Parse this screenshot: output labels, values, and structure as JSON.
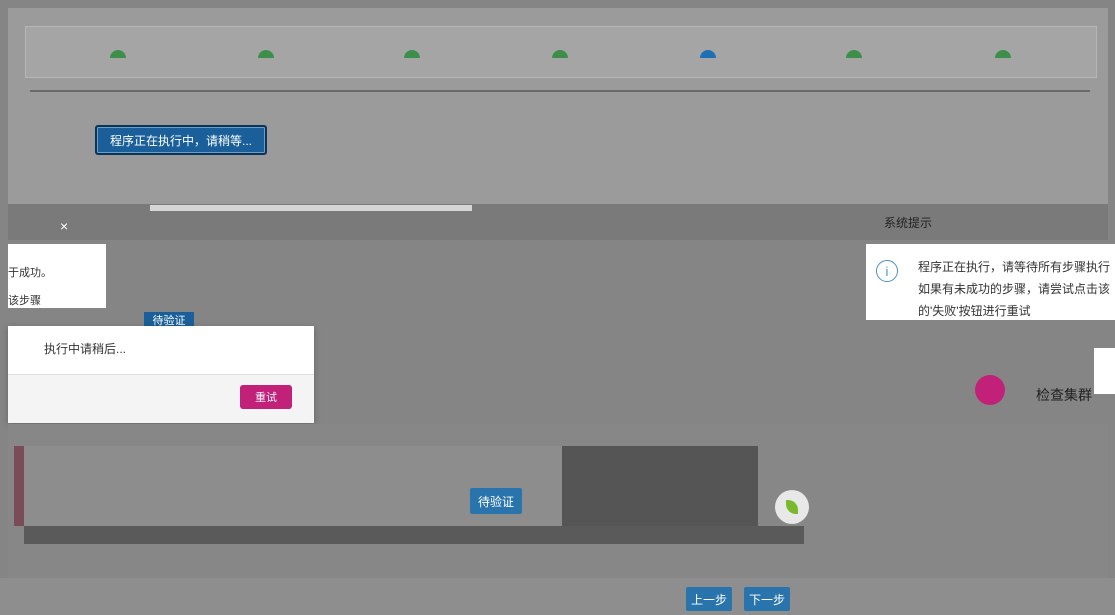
{
  "running_button": "程序正在执行中，请稍等...",
  "left_dialog": {
    "close": "×",
    "line1": "于成功。",
    "line2": "该步骤"
  },
  "toast": {
    "message": "执行中请稍后...",
    "retry": "重试"
  },
  "verify_small": "待验证",
  "verify_button": "待验证",
  "system_tip": {
    "title": "系统提示",
    "lines": [
      "程序正在执行，请等待所有步骤执行",
      "如果有未成功的步骤，请尝试点击该",
      "的'失败'按钮进行重试"
    ]
  },
  "check_label": "检查集群",
  "nav": {
    "prev": "上一步",
    "next": "下一步"
  },
  "colors": {
    "primary": "#2a74ad",
    "accent": "#c2217a",
    "step_done": "#3c8f4b"
  }
}
